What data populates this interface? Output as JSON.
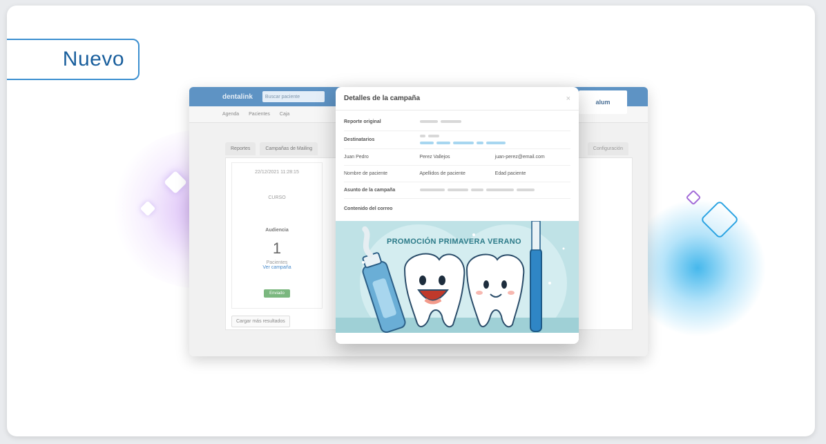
{
  "badge": {
    "label": "Nuevo"
  },
  "app": {
    "logo": "dentalink",
    "search_placeholder": "Buscar paciente",
    "user_label": "alum",
    "nav": [
      "Agenda",
      "Pacientes",
      "Caja"
    ],
    "tabs": [
      "Reportes",
      "Campañas de Mailing"
    ],
    "tab_right": "Configuración",
    "campaign": {
      "date": "22/12/2021 11:28:15",
      "type": "CURSO",
      "audience_label": "Audiencia",
      "audience_count": "1",
      "audience_sub": "Pacientes",
      "link": "Ver campaña",
      "status": "Enviado"
    },
    "more_button": "Cargar más resultados"
  },
  "modal": {
    "title": "Detalles de la campaña",
    "close": "×",
    "rows": {
      "report_label": "Reporte original",
      "recipients_label": "Destinatarios",
      "patient": {
        "first": "Juan Pedro",
        "last": "Perez Vallejos",
        "email": "juan-perez@email.com"
      },
      "fields": {
        "first": "Nombre de paciente",
        "last": "Apellidos de paciente",
        "age": "Edad paciente"
      },
      "subject_label": "Asunto de la campaña",
      "content_label": "Contenido del correo"
    },
    "promo_title": "PROMOCIÓN PRIMAVERA VERANO"
  }
}
